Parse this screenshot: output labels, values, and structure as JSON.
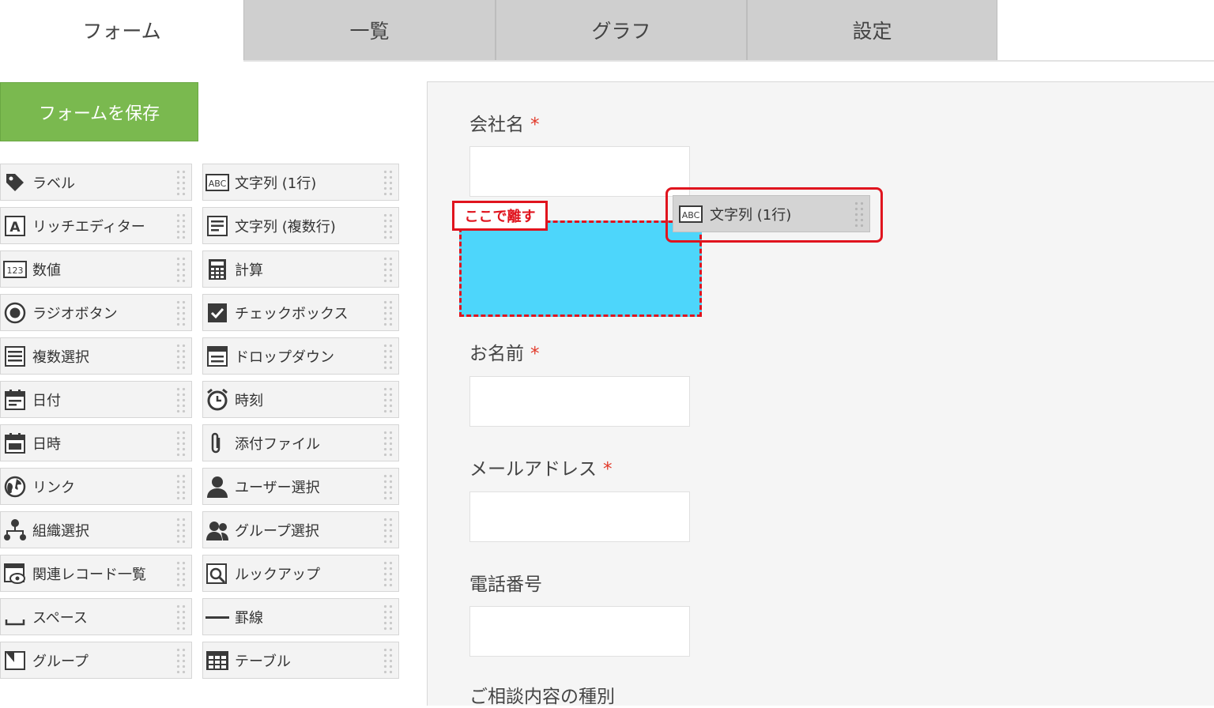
{
  "tabs": [
    {
      "label": "フォーム",
      "active": true
    },
    {
      "label": "一覧",
      "active": false
    },
    {
      "label": "グラフ",
      "active": false
    },
    {
      "label": "設定",
      "active": false
    }
  ],
  "save_button": "フォームを保存",
  "palette_left": [
    {
      "label": "ラベル",
      "icon": "tag-icon"
    },
    {
      "label": "リッチエディター",
      "icon": "rich-editor-icon"
    },
    {
      "label": "数値",
      "icon": "number-icon"
    },
    {
      "label": "ラジオボタン",
      "icon": "radio-icon"
    },
    {
      "label": "複数選択",
      "icon": "multi-select-icon"
    },
    {
      "label": "日付",
      "icon": "calendar-icon"
    },
    {
      "label": "日時",
      "icon": "datetime-icon"
    },
    {
      "label": "リンク",
      "icon": "globe-icon"
    },
    {
      "label": "組織選択",
      "icon": "org-icon"
    },
    {
      "label": "関連レコード一覧",
      "icon": "related-records-icon"
    },
    {
      "label": "スペース",
      "icon": "space-icon"
    },
    {
      "label": "グループ",
      "icon": "group-field-icon"
    }
  ],
  "palette_right": [
    {
      "label": "文字列 (1行)",
      "icon": "abc-icon"
    },
    {
      "label": "文字列 (複数行)",
      "icon": "multiline-text-icon"
    },
    {
      "label": "計算",
      "icon": "calculator-icon"
    },
    {
      "label": "チェックボックス",
      "icon": "checkbox-icon"
    },
    {
      "label": "ドロップダウン",
      "icon": "dropdown-icon"
    },
    {
      "label": "時刻",
      "icon": "clock-icon"
    },
    {
      "label": "添付ファイル",
      "icon": "paperclip-icon"
    },
    {
      "label": "ユーザー選択",
      "icon": "user-icon"
    },
    {
      "label": "グループ選択",
      "icon": "users-icon"
    },
    {
      "label": "ルックアップ",
      "icon": "lookup-icon"
    },
    {
      "label": "罫線",
      "icon": "rule-line-icon"
    },
    {
      "label": "テーブル",
      "icon": "table-icon"
    }
  ],
  "form_fields": [
    {
      "label": "会社名",
      "required": "*"
    },
    {
      "label": "お名前",
      "required": "*"
    },
    {
      "label": "メールアドレス",
      "required": "*"
    },
    {
      "label": "電話番号",
      "required": ""
    },
    {
      "label": "ご相談内容の種別",
      "required": ""
    }
  ],
  "drop_label": "ここで離す",
  "dragged_item": {
    "label": "文字列 (1行)",
    "icon": "abc-icon"
  },
  "colors": {
    "save": "#7ab94f",
    "drop_zone": "#4dd6fb",
    "highlight": "#e0141e",
    "required": "#e23a2a"
  }
}
